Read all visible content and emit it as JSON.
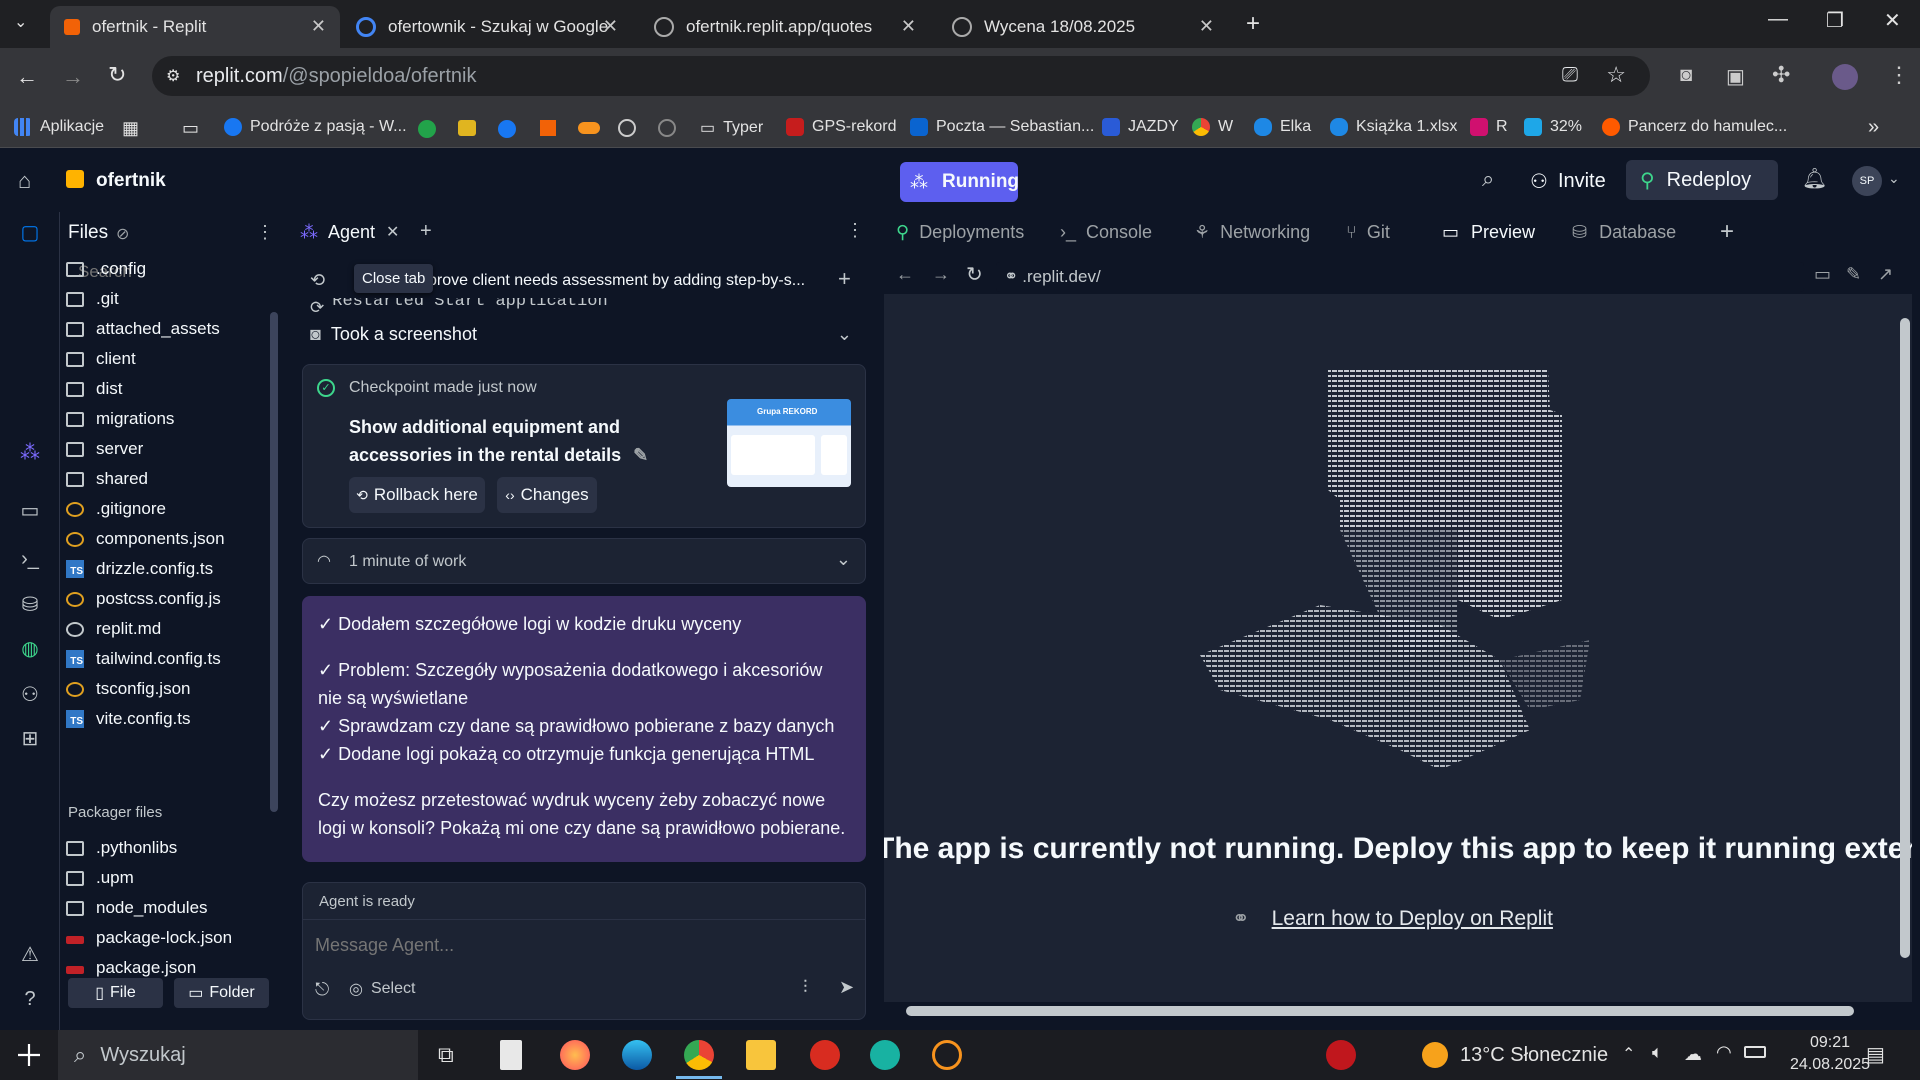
{
  "browser": {
    "tabs": [
      {
        "title": "ofertnik - Replit",
        "active": true
      },
      {
        "title": "ofertownik - Szukaj w Google",
        "active": false
      },
      {
        "title": "ofertnik.replit.app/quotes",
        "active": false
      },
      {
        "title": "Wycena 18/08.2025",
        "active": false
      }
    ],
    "url_host": "replit.com",
    "url_path": "/@spopieldoa/ofertnik",
    "bookmarks": [
      "Aplikacje",
      "Podróże z pasją - W...",
      "Typer",
      "GPS-rekord",
      "Poczta — Sebastian...",
      "JAZDY",
      "W",
      "Elka",
      "Książka 1.xlsx",
      "R",
      "32%",
      "Pancerz do hamulec..."
    ]
  },
  "replit": {
    "project": "ofertnik",
    "run_button": "Running",
    "invite": "Invite",
    "redeploy": "Redeploy",
    "avatar": "SP"
  },
  "files": {
    "title": "Files",
    "search_placeholder": "Search",
    "items": [
      ".config",
      ".git",
      "attached_assets",
      "client",
      "dist",
      "migrations",
      "server",
      "shared",
      ".gitignore",
      "components.json",
      "drizzle.config.ts",
      "postcss.config.js",
      "replit.md",
      "tailwind.config.ts",
      "tsconfig.json",
      "vite.config.ts"
    ],
    "packager_title": "Packager files",
    "packager_items": [
      ".pythonlibs",
      ".upm",
      "node_modules",
      "package-lock.json",
      "package.json"
    ],
    "new_file": "File",
    "new_folder": "Folder"
  },
  "agent": {
    "tab": "Agent",
    "tooltip": "Close tab",
    "thread_title": "prove client needs assessment by adding step-by-s...",
    "restarted": "Restarted Start application",
    "screenshot": "Took a screenshot",
    "checkpoint": "Checkpoint made just now",
    "checkpoint_title": "Show additional equipment and accessories in the rental details",
    "thumb_label": "Grupa REKORD",
    "rollback": "Rollback here",
    "changes": "Changes",
    "work": "1 minute of work",
    "msg_lines": [
      "✓ Dodałem szczegółowe logi w kodzie druku wyceny",
      "✓ Problem: Szczegóły wyposażenia dodatkowego i akcesoriów nie są wyświetlane",
      "✓ Sprawdzam czy dane są prawidłowo pobierane z bazy danych",
      "✓ Dodane logi pokażą co otrzymuje funkcja generująca HTML",
      "Czy możesz przetestować wydruk wyceny żeby zobaczyć nowe logi w konsoli? Pokażą mi one czy dane są prawidłowo pobierane."
    ],
    "status": "Agent is ready",
    "input_placeholder": "Message Agent...",
    "select": "Select"
  },
  "right": {
    "tabs": [
      "Deployments",
      "Console",
      "Networking",
      "Git",
      "Preview",
      "Database"
    ],
    "preview_url": ".replit.dev/",
    "not_running": "The app is currently not running. Deploy this app to keep it running externally.",
    "learn": "Learn how to Deploy on Replit"
  },
  "taskbar": {
    "search": "Wyszukaj",
    "weather": "13°C Słonecznie",
    "time": "09:21",
    "date": "24.08.2025"
  }
}
